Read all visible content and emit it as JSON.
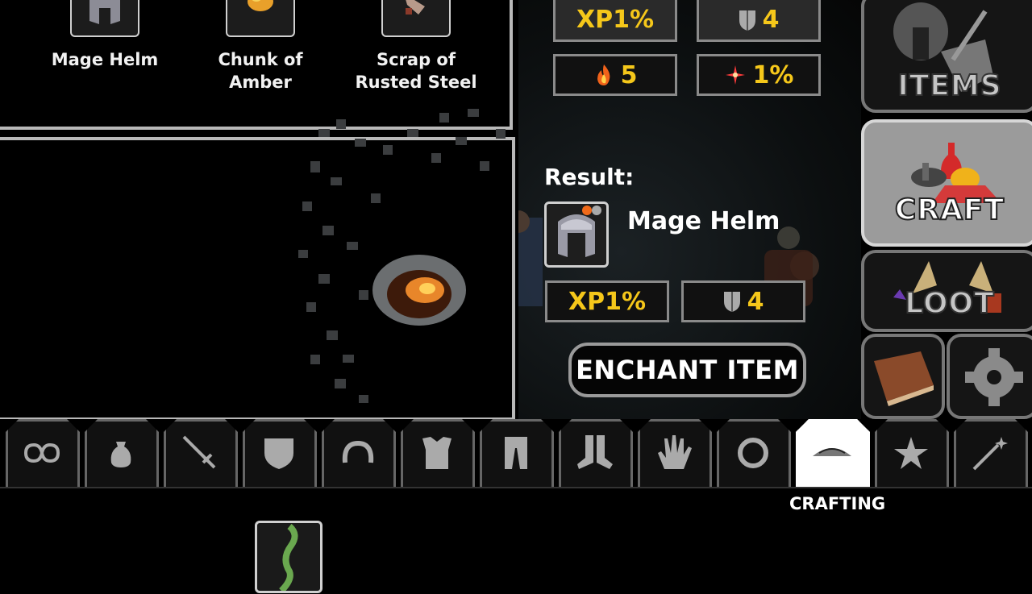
{
  "recipe": {
    "ingredients": [
      {
        "name": "Mage Helm",
        "icon": "helmet-icon"
      },
      {
        "name": "Chunk of Amber",
        "icon": "amber-icon"
      },
      {
        "name": "Scrap of Rusted Steel",
        "icon": "rusted-steel-icon"
      }
    ]
  },
  "stats_top": [
    {
      "icon": "",
      "value": "XP1%",
      "color": "#f5c71a"
    },
    {
      "icon": "shield-icon",
      "value": "4",
      "color": "#f5c71a"
    },
    {
      "icon": "fire-icon",
      "value": "5",
      "color": "#f5c71a"
    },
    {
      "icon": "spark-icon",
      "value": "1%",
      "color": "#f5c71a"
    }
  ],
  "result": {
    "label": "Result:",
    "item_name": "Mage Helm",
    "stats": [
      {
        "value": "XP1%"
      },
      {
        "icon": "shield-icon",
        "value": "4"
      }
    ],
    "enchant_label": "ENCHANT ITEM"
  },
  "side_menu": {
    "items": {
      "label": "ITEMS"
    },
    "craft": {
      "label": "CRAFT"
    },
    "loot": {
      "label": "LOOT"
    }
  },
  "tabs": [
    {
      "name": "all",
      "icon": "infinity-icon"
    },
    {
      "name": "bag",
      "icon": "bag-icon"
    },
    {
      "name": "weapon",
      "icon": "sword-icon"
    },
    {
      "name": "shield",
      "icon": "shield-icon"
    },
    {
      "name": "necklace",
      "icon": "necklace-icon"
    },
    {
      "name": "armor",
      "icon": "chest-armor-icon"
    },
    {
      "name": "legs",
      "icon": "pants-icon"
    },
    {
      "name": "boots",
      "icon": "boots-icon"
    },
    {
      "name": "gloves",
      "icon": "glove-icon"
    },
    {
      "name": "ring",
      "icon": "ring-icon"
    },
    {
      "name": "crafting",
      "icon": "crafting-pile-icon",
      "active": true
    },
    {
      "name": "favorites",
      "icon": "star-icon"
    },
    {
      "name": "magic",
      "icon": "wand-icon"
    }
  ],
  "active_tab_label": "CRAFTING",
  "colors": {
    "accent": "#f5c71a",
    "panel_border": "#b9b9b9",
    "active_tab": "#ffffff"
  }
}
